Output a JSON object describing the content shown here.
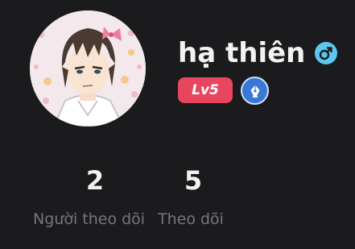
{
  "profile": {
    "username": "hạ thiên",
    "level_label": "Lv5",
    "gender_icon": "male-symbol-icon",
    "creator_icon": "pen-nib-icon"
  },
  "stats": {
    "followers": {
      "value": "2",
      "label": "Người theo dõi"
    },
    "following": {
      "value": "5",
      "label": "Theo dõi"
    }
  },
  "colors": {
    "background": "#1b1a1c",
    "gender_badge": "#5bc8ee",
    "level_badge": "#e8455f",
    "creator_badge": "#3a78d6",
    "label_text": "#77767a"
  }
}
